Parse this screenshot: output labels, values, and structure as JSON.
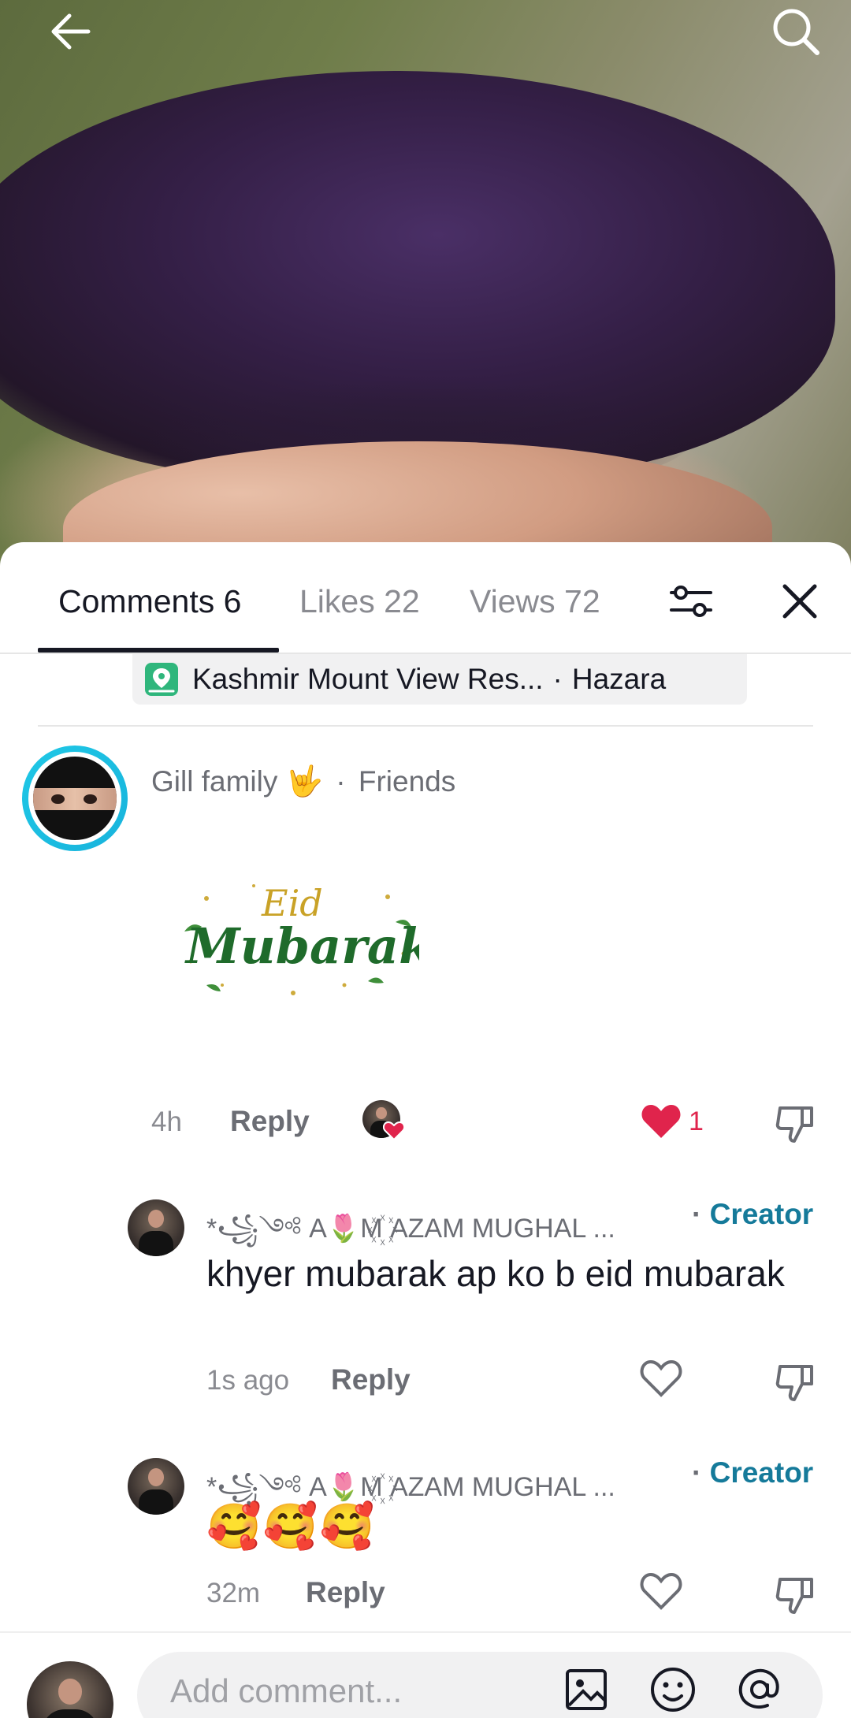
{
  "header": {
    "back_icon": "arrow-left-icon",
    "search_icon": "search-icon"
  },
  "tabs": [
    {
      "label": "Comments",
      "count": "6"
    },
    {
      "label": "Likes",
      "count": "22"
    },
    {
      "label": "Views",
      "count": "72"
    }
  ],
  "location": {
    "name": "Kashmir Mount View Res...",
    "region": "Hazara"
  },
  "comment": {
    "author": "Gill family",
    "relation": "Friends",
    "sticker_text_1": "Eid",
    "sticker_text_2": "Mubarak",
    "time": "4h",
    "reply_label": "Reply",
    "like_count": "1"
  },
  "replies": [
    {
      "author": "*꧁༺ A🌷M꙰ AZAM MUGHAL ...",
      "badge": "Creator",
      "text": "khyer mubarak ap ko b eid mubarak",
      "time": "1s ago",
      "reply_label": "Reply"
    },
    {
      "author": "*꧁༺ A🌷M꙰ AZAM MUGHAL ...",
      "badge": "Creator",
      "text": "🥰🥰🥰",
      "time": "32m",
      "reply_label": "Reply"
    }
  ],
  "composer": {
    "placeholder": "Add comment..."
  },
  "colors": {
    "creator": "#157a9a",
    "like": "#e0244c",
    "ring": "#1fc8e6"
  }
}
